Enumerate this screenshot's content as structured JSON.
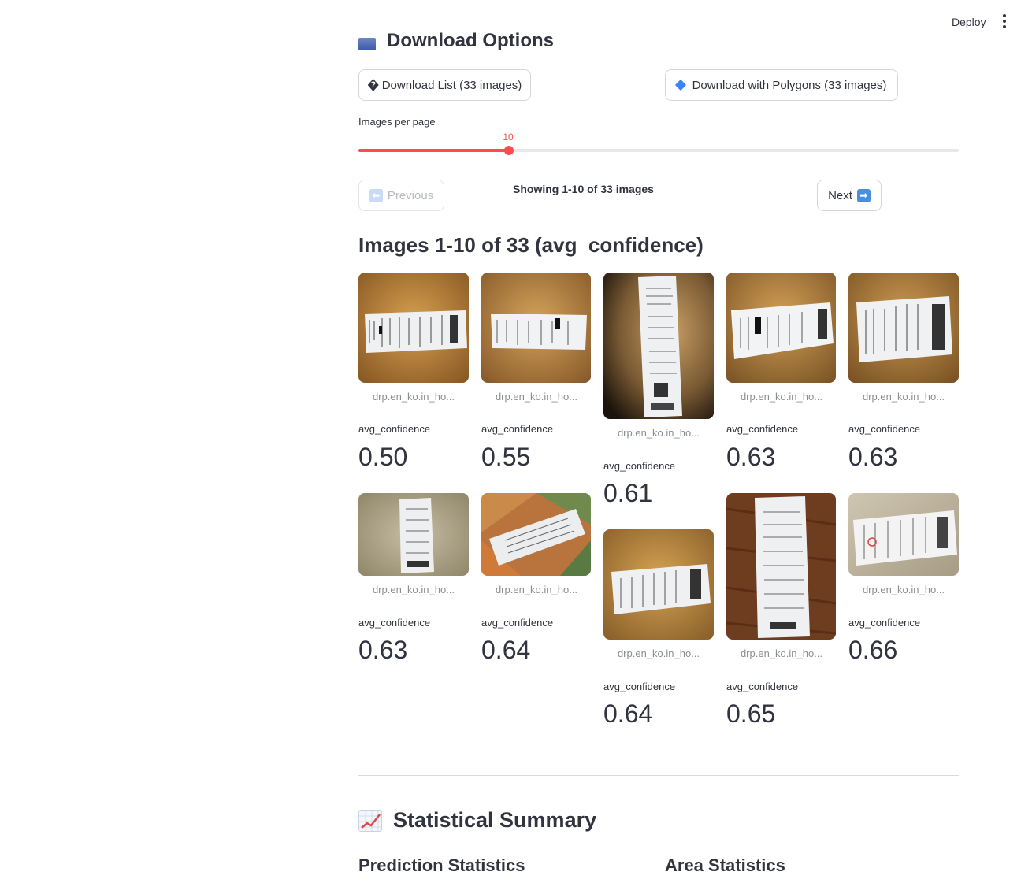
{
  "header": {
    "deploy_label": "Deploy"
  },
  "download": {
    "heading": "Download Options",
    "list_button": "Download List (33 images)",
    "polygons_button": "Download with Polygons (33 images)"
  },
  "slider": {
    "label": "Images per page",
    "value": "10",
    "fraction": 0.25
  },
  "pagination": {
    "previous_label": "Previous",
    "next_label": "Next",
    "showing_text": "Showing 1-10 of 33 images"
  },
  "gallery": {
    "title": "Images 1-10 of 33 (avg_confidence)",
    "items": [
      {
        "caption": "drp.en_ko.in_ho...",
        "metric_label": "avg_confidence",
        "value": "0.50"
      },
      {
        "caption": "drp.en_ko.in_ho...",
        "metric_label": "avg_confidence",
        "value": "0.55"
      },
      {
        "caption": "drp.en_ko.in_ho...",
        "metric_label": "avg_confidence",
        "value": "0.61"
      },
      {
        "caption": "drp.en_ko.in_ho...",
        "metric_label": "avg_confidence",
        "value": "0.63"
      },
      {
        "caption": "drp.en_ko.in_ho...",
        "metric_label": "avg_confidence",
        "value": "0.63"
      },
      {
        "caption": "drp.en_ko.in_ho...",
        "metric_label": "avg_confidence",
        "value": "0.63"
      },
      {
        "caption": "drp.en_ko.in_ho...",
        "metric_label": "avg_confidence",
        "value": "0.64"
      },
      {
        "caption": "drp.en_ko.in_ho...",
        "metric_label": "avg_confidence",
        "value": "0.64"
      },
      {
        "caption": "drp.en_ko.in_ho...",
        "metric_label": "avg_confidence",
        "value": "0.65"
      },
      {
        "caption": "drp.en_ko.in_ho...",
        "metric_label": "avg_confidence",
        "value": "0.66"
      }
    ]
  },
  "stats": {
    "title": "Statistical Summary",
    "prediction_title": "Prediction Statistics",
    "area_title": "Area Statistics"
  },
  "colors": {
    "accent": "#ff4b4b",
    "text": "#31333f",
    "muted": "#8a8d93",
    "border": "#d5d6d9"
  }
}
